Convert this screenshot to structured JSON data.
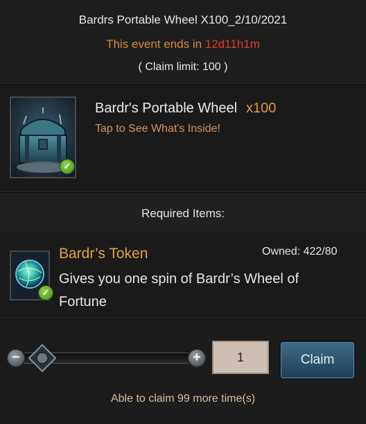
{
  "header": {
    "title": "Bardrs Portable Wheel X100_2/10/2021",
    "event_prefix": "This event ends in ",
    "event_countdown": "12d11h1m",
    "claim_limit": "( Claim limit: 100 )"
  },
  "reward": {
    "name": "Bardr's Portable Wheel",
    "quantity": "x100",
    "hint": "Tap to See What's Inside!",
    "icon": "treasure-chest-icon"
  },
  "required": {
    "label": "Required Items:"
  },
  "token": {
    "name": "Bardr’s Token",
    "owned": "Owned: 422/80",
    "description": "Gives you one spin of Bardr’s Wheel of Fortune",
    "icon": "token-orb-icon"
  },
  "claim": {
    "minus_symbol": "−",
    "plus_symbol": "+",
    "quantity": "1",
    "button_label": "Claim",
    "note": "Able to claim 99 more time(s)"
  },
  "colors": {
    "accent_orange": "#e39a36",
    "countdown_red": "#e23a2a",
    "claim_button": "#2f5672",
    "check_green": "#5fae2f"
  }
}
